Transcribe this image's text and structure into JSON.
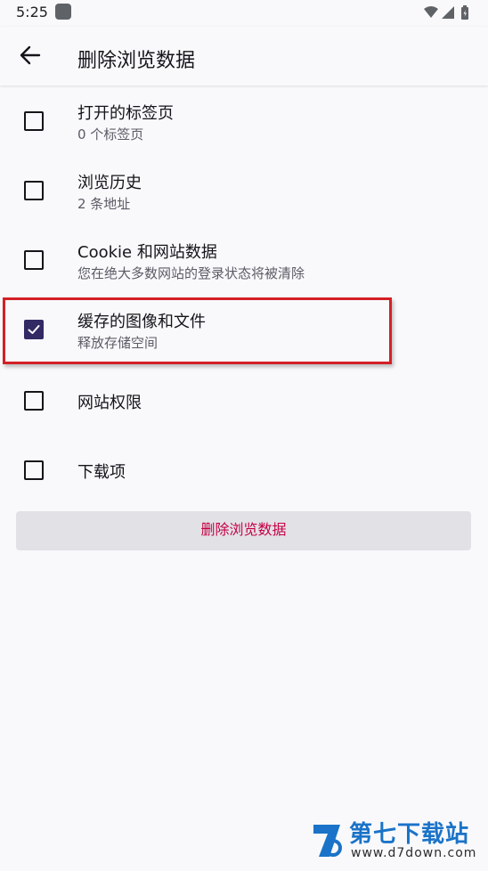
{
  "status_bar": {
    "time": "5:25",
    "icons": [
      "app-notification-icon",
      "wifi-icon",
      "signal-icon",
      "battery-icon"
    ]
  },
  "toolbar": {
    "back_icon": "arrow-left-icon",
    "title": "删除浏览数据"
  },
  "items": [
    {
      "title": "打开的标签页",
      "subtitle": "0 个标签页",
      "checked": false
    },
    {
      "title": "浏览历史",
      "subtitle": "2 条地址",
      "checked": false
    },
    {
      "title": "Cookie 和网站数据",
      "subtitle": "您在绝大多数网站的登录状态将被清除",
      "checked": false
    },
    {
      "title": "缓存的图像和文件",
      "subtitle": "释放存储空间",
      "checked": true
    },
    {
      "title": "网站权限",
      "subtitle": "",
      "checked": false
    },
    {
      "title": "下载项",
      "subtitle": "",
      "checked": false
    }
  ],
  "delete_button": {
    "label": "删除浏览数据"
  },
  "colors": {
    "accent": "#312a64",
    "delete_text": "#c50042",
    "button_bg": "#e2e1e6",
    "highlight": "#d32026"
  },
  "watermark": {
    "name": "第七下载站",
    "url": "www.d7down.com"
  }
}
